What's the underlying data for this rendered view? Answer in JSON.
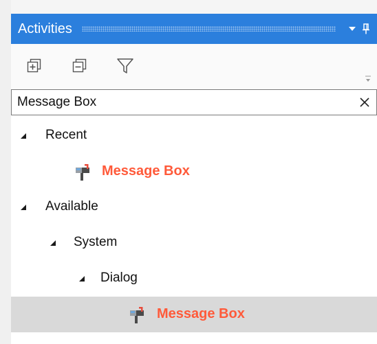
{
  "panel": {
    "title": "Activities",
    "title_color": "#2b7fdd",
    "buttons": [
      "dropdown-icon",
      "pin-icon"
    ]
  },
  "toolbar": {
    "buttons": [
      "expand-all-icon",
      "collapse-all-icon",
      "filter-icon"
    ],
    "overflow": "overflow-icon"
  },
  "search": {
    "value": "Message Box",
    "clear_glyph": "×"
  },
  "tree": {
    "highlight_color": "#ff5a3a",
    "nodes": [
      {
        "label": "Recent",
        "level": 0,
        "type": "category",
        "expanded": true
      },
      {
        "label": "Message Box",
        "level": 1,
        "type": "activity",
        "icon": "message-box-icon"
      },
      {
        "label": "Available",
        "level": 0,
        "type": "category",
        "expanded": true
      },
      {
        "label": "System",
        "level": 1,
        "type": "category",
        "expanded": true
      },
      {
        "label": "Dialog",
        "level": 2,
        "type": "category",
        "expanded": true
      },
      {
        "label": "Message Box",
        "level": 3,
        "type": "activity",
        "icon": "message-box-icon",
        "selected": true
      }
    ]
  }
}
